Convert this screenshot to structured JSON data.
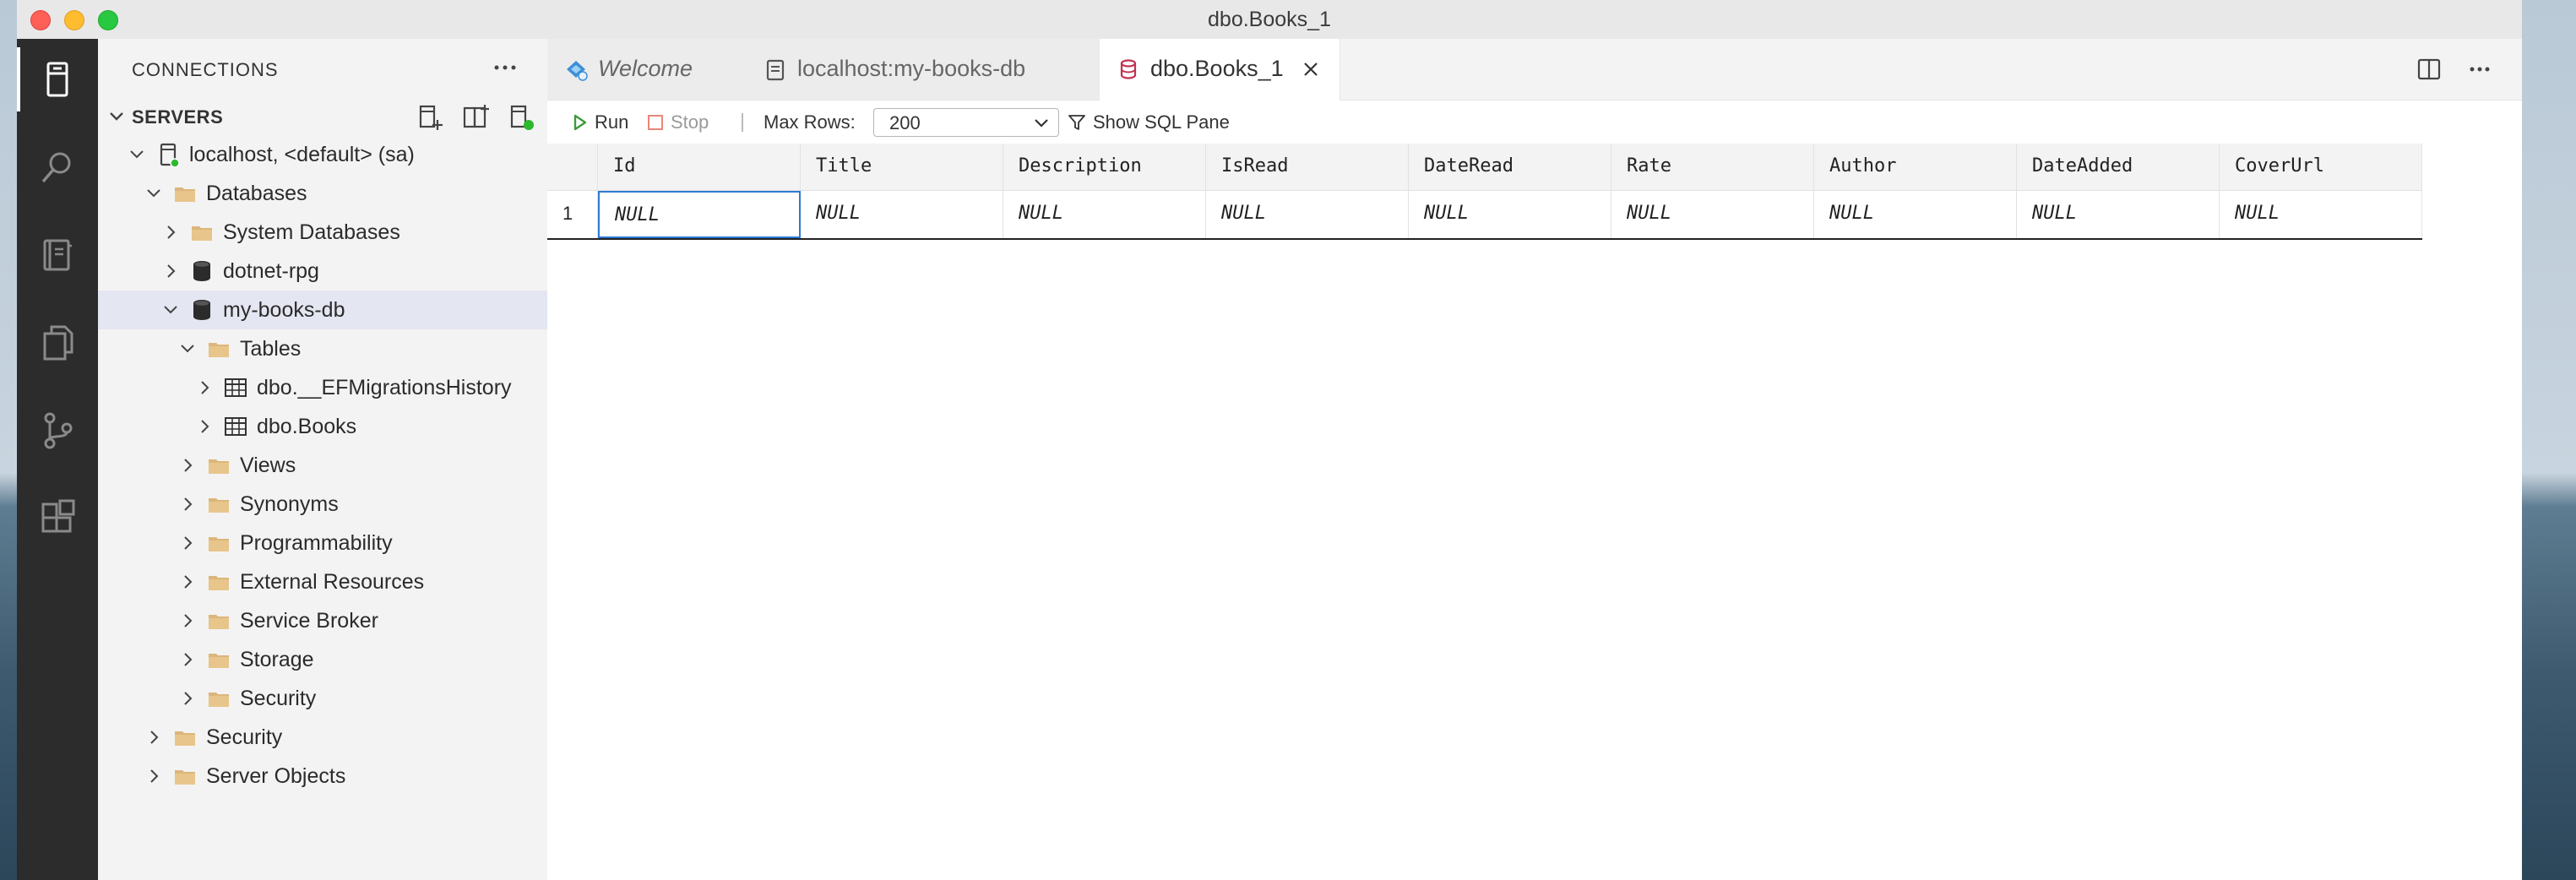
{
  "window": {
    "title": "dbo.Books_1",
    "traffic_lights": [
      "#fe5f57",
      "#febc2e",
      "#28c840"
    ]
  },
  "activity_bar": [
    {
      "icon": "connections-icon",
      "active": true
    },
    {
      "icon": "search-icon",
      "active": false
    },
    {
      "icon": "notebook-icon",
      "active": false
    },
    {
      "icon": "explorer-icon",
      "active": false
    },
    {
      "icon": "source-control-icon",
      "active": false
    },
    {
      "icon": "extensions-icon",
      "active": false
    }
  ],
  "sidebar": {
    "title": "CONNECTIONS",
    "section": "SERVERS",
    "tree": [
      {
        "label": "localhost, <default> (sa)",
        "icon": "server-icon",
        "expanded": true,
        "selected": false
      },
      {
        "label": "Databases",
        "icon": "folder-icon",
        "expanded": true,
        "selected": false
      },
      {
        "label": "System Databases",
        "icon": "folder-icon",
        "expanded": false,
        "selected": false
      },
      {
        "label": "dotnet-rpg",
        "icon": "database-icon",
        "expanded": false,
        "selected": false
      },
      {
        "label": "my-books-db",
        "icon": "database-icon",
        "expanded": true,
        "selected": true
      },
      {
        "label": "Tables",
        "icon": "folder-icon",
        "expanded": true,
        "selected": false
      },
      {
        "label": "dbo.__EFMigrationsHistory",
        "icon": "table-icon",
        "expanded": false,
        "selected": false
      },
      {
        "label": "dbo.Books",
        "icon": "table-icon",
        "expanded": false,
        "selected": false
      },
      {
        "label": "Views",
        "icon": "folder-icon",
        "expanded": false,
        "selected": false
      },
      {
        "label": "Synonyms",
        "icon": "folder-icon",
        "expanded": false,
        "selected": false
      },
      {
        "label": "Programmability",
        "icon": "folder-icon",
        "expanded": false,
        "selected": false
      },
      {
        "label": "External Resources",
        "icon": "folder-icon",
        "expanded": false,
        "selected": false
      },
      {
        "label": "Service Broker",
        "icon": "folder-icon",
        "expanded": false,
        "selected": false
      },
      {
        "label": "Storage",
        "icon": "folder-icon",
        "expanded": false,
        "selected": false
      },
      {
        "label": "Security",
        "icon": "folder-icon",
        "expanded": false,
        "selected": false
      },
      {
        "label": "Security",
        "icon": "folder-icon",
        "expanded": false,
        "selected": false
      },
      {
        "label": "Server Objects",
        "icon": "folder-icon",
        "expanded": false,
        "selected": false
      }
    ]
  },
  "tabs": [
    {
      "label": "Welcome",
      "icon": "welcome-icon",
      "active": false
    },
    {
      "label": "localhost:my-books-db",
      "icon": "query-file-icon",
      "active": false
    },
    {
      "label": "dbo.Books_1",
      "icon": "table-edit-icon",
      "active": true
    }
  ],
  "toolbar": {
    "run_label": "Run",
    "stop_label": "Stop",
    "max_rows_label": "Max Rows:",
    "max_rows_value": "200",
    "show_sql_label": "Show SQL Pane"
  },
  "grid": {
    "columns": [
      "Id",
      "Title",
      "Description",
      "IsRead",
      "DateRead",
      "Rate",
      "Author",
      "DateAdded",
      "CoverUrl"
    ],
    "rows": [
      {
        "num": "1",
        "cells": [
          "NULL",
          "NULL",
          "NULL",
          "NULL",
          "NULL",
          "NULL",
          "NULL",
          "NULL",
          "NULL"
        ]
      }
    ]
  },
  "colors": {
    "accent": "#2d7ad3",
    "folder": "#dcb67a",
    "run_green": "#3c9a3c",
    "stop_red": "#e0533f",
    "status_green": "#2eb82e"
  }
}
